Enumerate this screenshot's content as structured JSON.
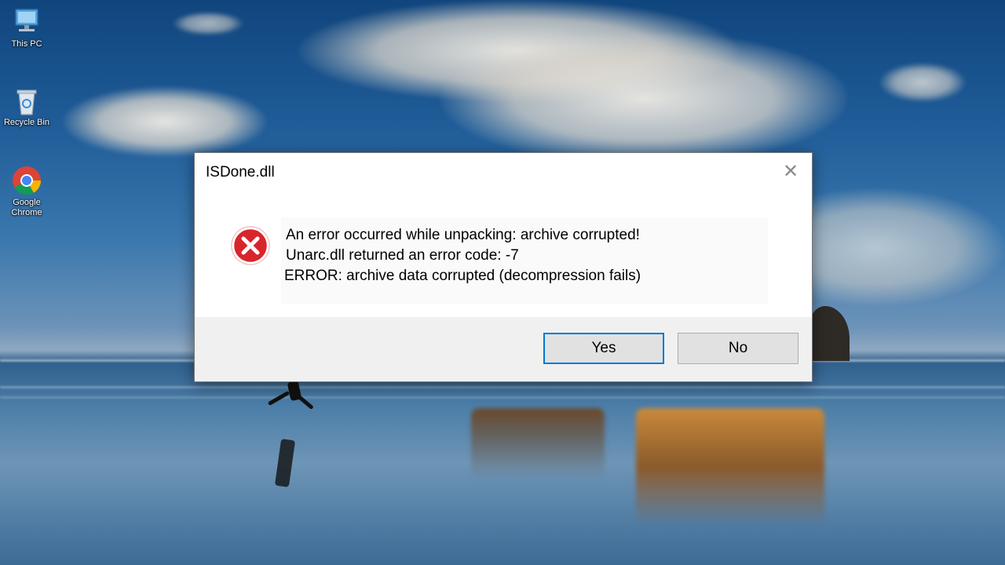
{
  "desktop": {
    "icons": [
      {
        "label": "This PC",
        "icon": "this-pc-icon"
      },
      {
        "label": "Recycle Bin",
        "icon": "recycle-bin-icon"
      },
      {
        "label": "Google Chrome",
        "icon": "chrome-icon"
      }
    ]
  },
  "dialog": {
    "title": "ISDone.dll",
    "close_glyph": "✕",
    "icon": "error-icon",
    "messages": [
      "An error occurred while unpacking: archive corrupted!",
      "Unarc.dll returned an error code: -7",
      "ERROR: archive data corrupted  (decompression fails)"
    ],
    "buttons": {
      "yes": "Yes",
      "no": "No"
    },
    "colors": {
      "error_red": "#d8252b",
      "focus_border": "#0078d7"
    }
  }
}
